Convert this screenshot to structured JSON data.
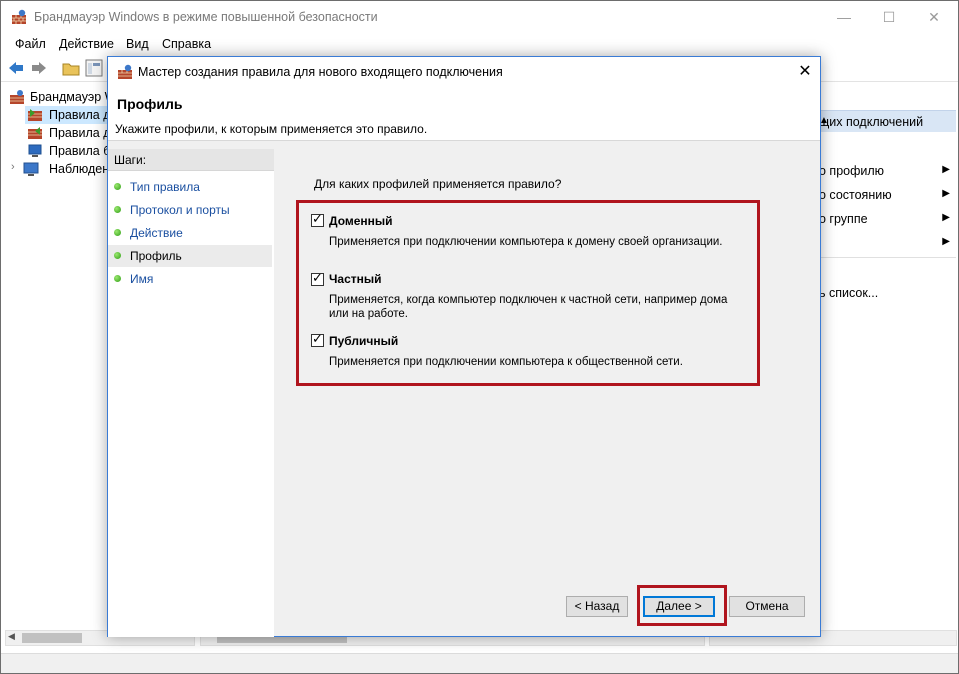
{
  "main_window": {
    "title": "Брандмауэр Windows в режиме повышенной безопасности",
    "menu": [
      "Файл",
      "Действие",
      "Вид",
      "Справка"
    ],
    "tree": [
      {
        "label": "Брандмауэр Wind"
      },
      {
        "label": "Правила для"
      },
      {
        "label": "Правила для"
      },
      {
        "label": "Правила бе"
      },
      {
        "label": "Наблюдение"
      }
    ],
    "actions_header": "щих подключений",
    "actions": [
      {
        "label": "о профилю",
        "has_arrow": true
      },
      {
        "label": "о состоянию",
        "has_arrow": true
      },
      {
        "label": "о группе",
        "has_arrow": true
      },
      {
        "label": "",
        "has_arrow": true
      },
      {
        "label": "ь список...",
        "has_arrow": false
      }
    ]
  },
  "dialog": {
    "title": "Мастер создания правила для нового входящего подключения",
    "heading": "Профиль",
    "subheading": "Укажите профили, к которым применяется это правило.",
    "steps_title": "Шаги:",
    "steps": [
      {
        "label": "Тип правила",
        "active": false
      },
      {
        "label": "Протокол и порты",
        "active": false
      },
      {
        "label": "Действие",
        "active": false
      },
      {
        "label": "Профиль",
        "active": true
      },
      {
        "label": "Имя",
        "active": false
      }
    ],
    "question": "Для каких профилей применяется правило?",
    "profiles": [
      {
        "name": "Доменный",
        "checked": true,
        "description": "Применяется при подключении компьютера к домену своей организации."
      },
      {
        "name": "Частный",
        "checked": true,
        "description": "Применяется, когда компьютер подключен к частной сети, например дома или на работе."
      },
      {
        "name": "Публичный",
        "checked": true,
        "description": "Применяется при подключении компьютера к общественной сети."
      }
    ],
    "buttons": {
      "back": "< Назад",
      "next": "Далее >",
      "cancel": "Отмена"
    }
  },
  "colors": {
    "highlight_frame": "#b0151e",
    "accent": "#0078d7",
    "link": "#1a4fa0"
  }
}
